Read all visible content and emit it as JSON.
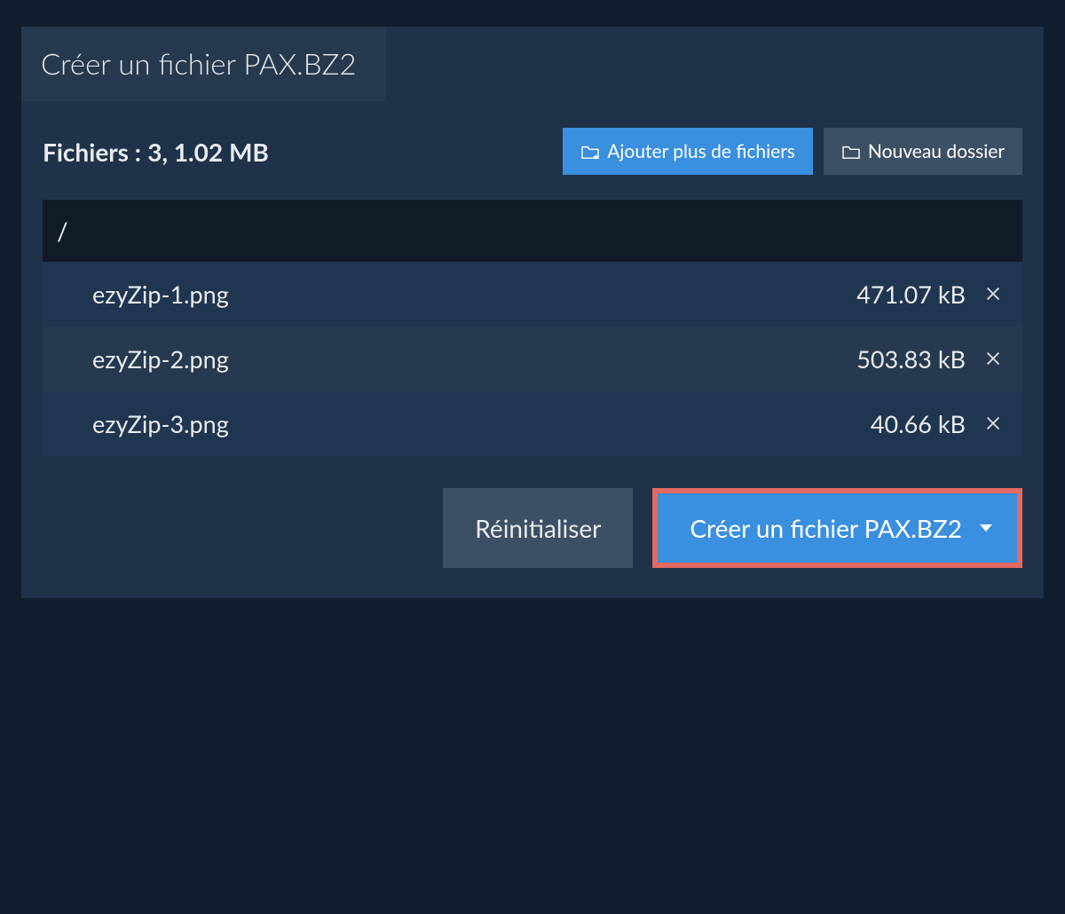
{
  "tab_title": "Créer un fichier PAX.BZ2",
  "files_label": "Fichiers :",
  "files_count": "3",
  "files_total": "1.02 MB",
  "add_files_label": "Ajouter plus de fichiers",
  "new_folder_label": "Nouveau dossier",
  "path": "/",
  "files": [
    {
      "name": "ezyZip-1.png",
      "size": "471.07 kB"
    },
    {
      "name": "ezyZip-2.png",
      "size": "503.83 kB"
    },
    {
      "name": "ezyZip-3.png",
      "size": "40.66 kB"
    }
  ],
  "reset_label": "Réinitialiser",
  "create_label": "Créer un fichier PAX.BZ2"
}
